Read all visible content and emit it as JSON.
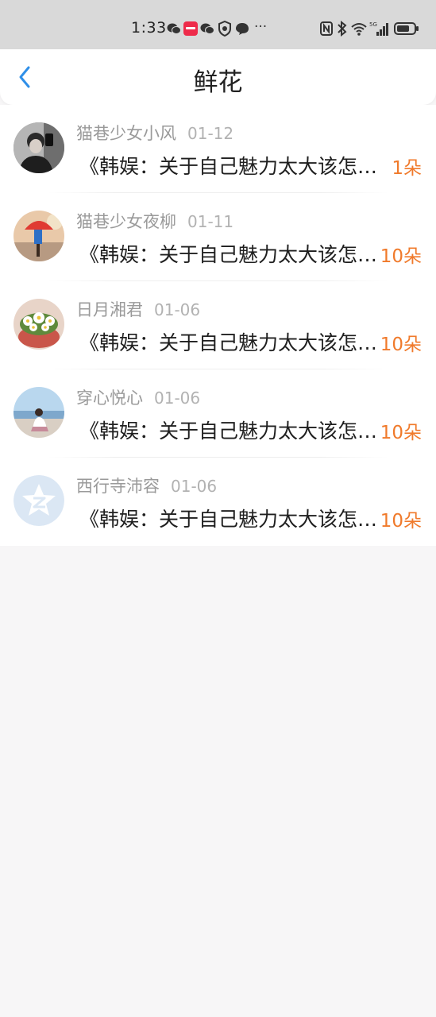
{
  "status_bar": {
    "time": "1:33",
    "ellipsis": "···"
  },
  "header": {
    "title": "鲜花",
    "back_icon": "chevron-left-icon",
    "accent_color": "#2f8fe8"
  },
  "items": [
    {
      "name": "猫巷少女小风",
      "date": "01-12",
      "title": "《韩娱：关于自己魅力太大该怎么办》",
      "count": "1朵",
      "avatar": "photo-portrait"
    },
    {
      "name": "猫巷少女夜柳",
      "date": "01-11",
      "title": "《韩娱：关于自己魅力太大该怎么办》",
      "count": "10朵",
      "avatar": "photo-umbrella"
    },
    {
      "name": "日月湘君",
      "date": "01-06",
      "title": "《韩娱：关于自己魅力太大该怎么办》",
      "count": "10朵",
      "avatar": "photo-flowers"
    },
    {
      "name": "穿心悦心",
      "date": "01-06",
      "title": "《韩娱：关于自己魅力太大该怎么办》",
      "count": "10朵",
      "avatar": "photo-beach"
    },
    {
      "name": "西行寺沛容",
      "date": "01-06",
      "title": "《韩娱：关于自己魅力太大该怎么办》",
      "count": "10朵",
      "avatar": "default-avatar-icon"
    }
  ],
  "colors": {
    "count": "#f07a2b",
    "page_background": "#f7f6f7",
    "status_bar": "#d9d9d9"
  }
}
